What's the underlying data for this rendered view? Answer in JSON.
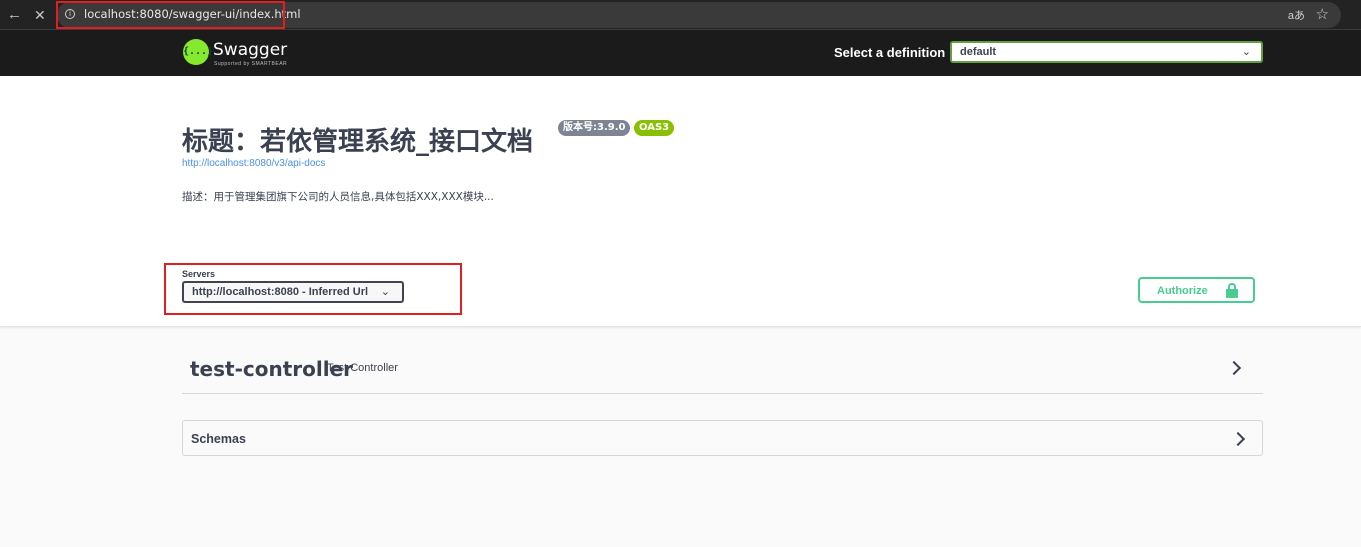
{
  "browser": {
    "url": "localhost:8080/swagger-ui/index.html",
    "back_icon": "←",
    "stop_icon": "✕",
    "read_aloud_icon": "aあ",
    "favorite_icon": "☆"
  },
  "topbar": {
    "logo_mark": "{...}",
    "logo_name": "Swagger",
    "logo_sub": "Supported by SMARTBEAR",
    "definition_label": "Select a definition",
    "definition_value": "default",
    "chevron": "⌄"
  },
  "info": {
    "title": "标题：若依管理系统_接口文档",
    "version_badge": "版本号:3.9.0",
    "oas_badge": "OAS3",
    "docs_url": "http://localhost:8080/v3/api-docs",
    "description": "描述：用于管理集团旗下公司的人员信息,具体包括XXX,XXX模块..."
  },
  "servers": {
    "label": "Servers",
    "selected": "http://localhost:8080 - Inferred Url",
    "chevron": "⌄"
  },
  "authorize": {
    "label": "Authorize"
  },
  "tags": [
    {
      "name": "test-controller",
      "description": "Test Controller"
    }
  ],
  "schemas": {
    "label": "Schemas"
  },
  "colors": {
    "accent_green": "#49cc90",
    "swagger_green": "#85ea2d",
    "highlight_red": "#e02020"
  }
}
